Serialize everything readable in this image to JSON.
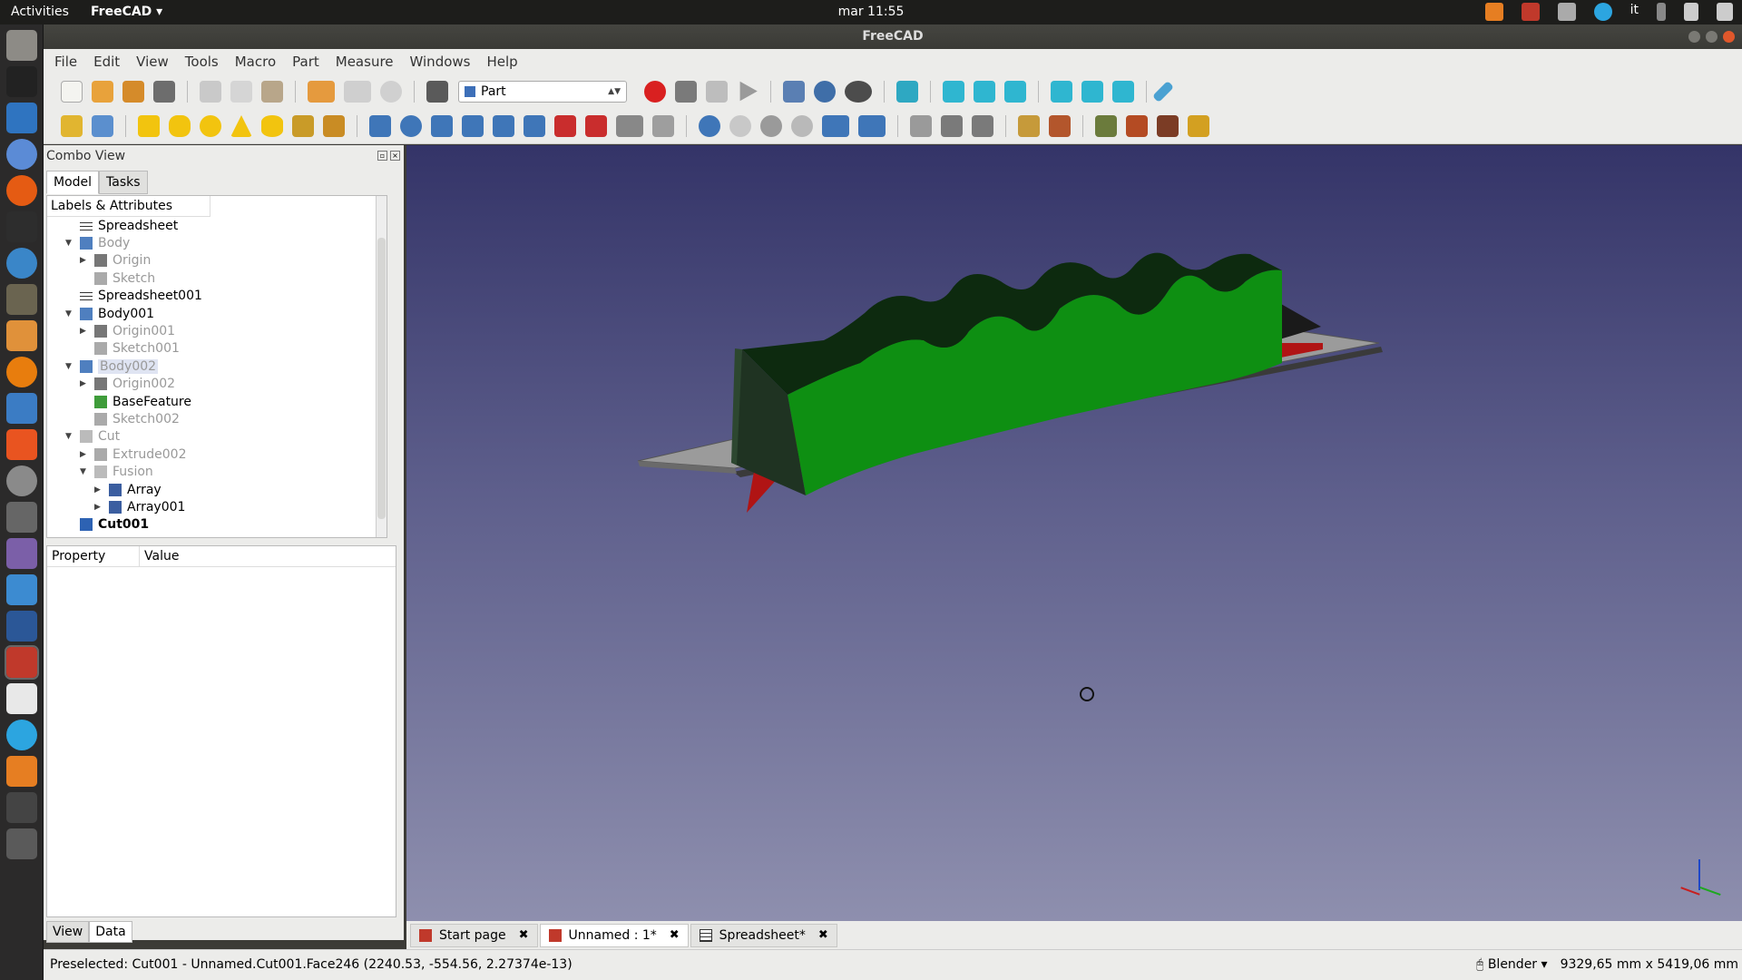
{
  "system_bar": {
    "activities": "Activities",
    "app_name": "FreeCAD",
    "clock": "mar 11:55",
    "lang": "it"
  },
  "window": {
    "title": "FreeCAD"
  },
  "menu": [
    "File",
    "Edit",
    "View",
    "Tools",
    "Macro",
    "Part",
    "Measure",
    "Windows",
    "Help"
  ],
  "workbench": {
    "selected": "Part"
  },
  "combo": {
    "title": "Combo View",
    "tabs": [
      "Model",
      "Tasks"
    ],
    "tree_header": "Labels & Attributes"
  },
  "tree": [
    {
      "label": "Spreadsheet",
      "level": 0,
      "expander": "",
      "icon": "spreadsheet-icon",
      "style": "normal"
    },
    {
      "label": "Body",
      "level": 0,
      "expander": "open",
      "icon": "body-icon",
      "style": "dim"
    },
    {
      "label": "Origin",
      "level": 1,
      "expander": "closed",
      "icon": "origin-icon",
      "style": "dim"
    },
    {
      "label": "Sketch",
      "level": 1,
      "expander": "",
      "icon": "sketch-icon",
      "style": "dim"
    },
    {
      "label": "Spreadsheet001",
      "level": 0,
      "expander": "",
      "icon": "spreadsheet-icon",
      "style": "normal"
    },
    {
      "label": "Body001",
      "level": 0,
      "expander": "open",
      "icon": "body-icon",
      "style": "normal"
    },
    {
      "label": "Origin001",
      "level": 1,
      "expander": "closed",
      "icon": "origin-icon",
      "style": "dim"
    },
    {
      "label": "Sketch001",
      "level": 1,
      "expander": "",
      "icon": "sketch-icon",
      "style": "dim"
    },
    {
      "label": "Body002",
      "level": 0,
      "expander": "open",
      "icon": "body-icon",
      "style": "dim-selected"
    },
    {
      "label": "Origin002",
      "level": 1,
      "expander": "closed",
      "icon": "origin-icon",
      "style": "dim"
    },
    {
      "label": "BaseFeature",
      "level": 1,
      "expander": "",
      "icon": "basefeature-icon",
      "style": "normal"
    },
    {
      "label": "Sketch002",
      "level": 1,
      "expander": "",
      "icon": "sketch-icon",
      "style": "dim"
    },
    {
      "label": "Cut",
      "level": 0,
      "expander": "open",
      "icon": "cut-icon",
      "style": "dim"
    },
    {
      "label": "Extrude002",
      "level": 1,
      "expander": "closed",
      "icon": "extrude-icon",
      "style": "dim"
    },
    {
      "label": "Fusion",
      "level": 1,
      "expander": "open",
      "icon": "fusion-icon",
      "style": "dim"
    },
    {
      "label": "Array",
      "level": 2,
      "expander": "closed",
      "icon": "array-icon",
      "style": "normal"
    },
    {
      "label": "Array001",
      "level": 2,
      "expander": "closed",
      "icon": "array-icon",
      "style": "normal"
    },
    {
      "label": "Cut001",
      "level": 0,
      "expander": "",
      "icon": "cut-solid-icon",
      "style": "bold"
    }
  ],
  "properties": {
    "col_property": "Property",
    "col_value": "Value",
    "tabs": [
      "View",
      "Data"
    ]
  },
  "doc_tabs": [
    {
      "label": "Start page",
      "icon": "freecad-icon",
      "active": false
    },
    {
      "label": "Unnamed : 1*",
      "icon": "freecad-icon",
      "active": true
    },
    {
      "label": "Spreadsheet*",
      "icon": "spreadsheet-icon",
      "active": false
    }
  ],
  "status": {
    "message": "Preselected: Cut001 - Unnamed.Cut001.Face246 (2240.53, -554.56, 2.27374e-13)",
    "navigation": "Blender",
    "dimensions": "9329,65 mm x 5419,06 mm"
  },
  "colors": {
    "green": "#0e8f12",
    "red": "#c41010",
    "base": "#9b9b9b"
  }
}
